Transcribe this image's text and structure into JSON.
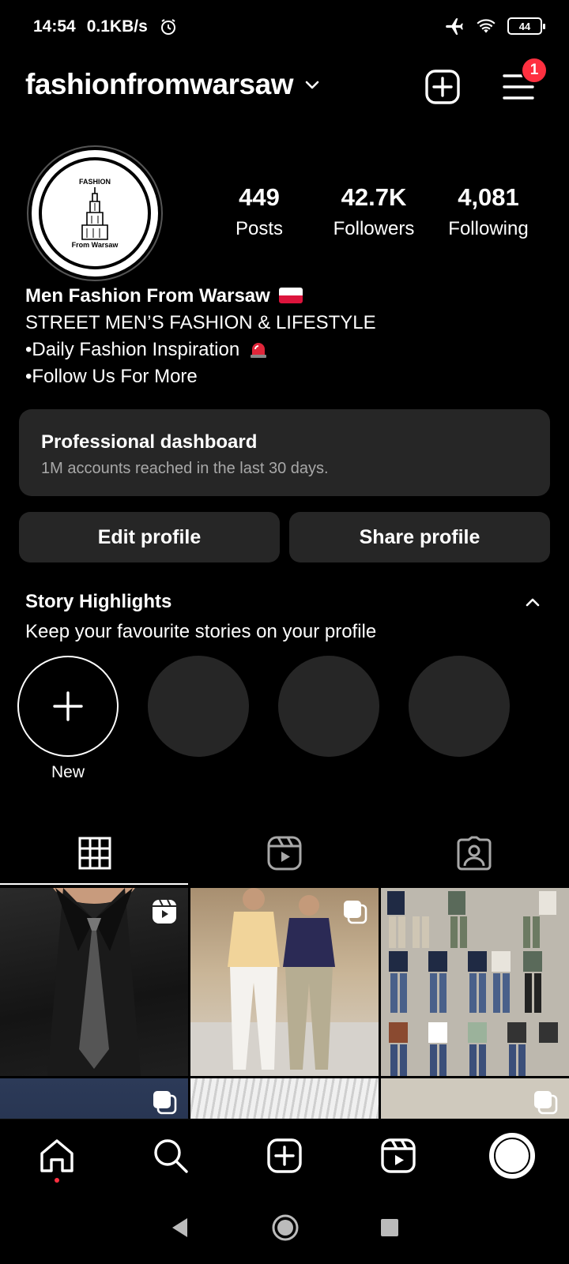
{
  "status_bar": {
    "time": "14:54",
    "network_speed": "0.1KB/s",
    "battery": "44"
  },
  "header": {
    "username": "fashionfromwarsaw",
    "notification_count": "1"
  },
  "profile": {
    "avatar_text_top": "FASHION",
    "avatar_text_bottom": "From Warsaw",
    "stats": [
      {
        "value": "449",
        "label": "Posts"
      },
      {
        "value": "42.7K",
        "label": "Followers"
      },
      {
        "value": "4,081",
        "label": "Following"
      }
    ],
    "bio": {
      "name": "Men Fashion From Warsaw",
      "line1": "STREET MEN’S FASHION & LIFESTYLE",
      "line2": "•Daily Fashion Inspiration",
      "line3": "•Follow Us For More"
    }
  },
  "dashboard": {
    "title": "Professional dashboard",
    "subtitle": "1M accounts reached in the last 30 days."
  },
  "buttons": {
    "edit": "Edit profile",
    "share": "Share profile"
  },
  "highlights": {
    "title": "Story Highlights",
    "subtitle": "Keep your favourite stories on your profile",
    "new_label": "New"
  },
  "colors": {
    "background": "#000000",
    "card": "#262626",
    "badge": "#ff3040",
    "muted_text": "#a8a8a8"
  },
  "icons": [
    "chevron-down-icon",
    "new-post-icon",
    "menu-icon",
    "plus-icon",
    "chevron-up-icon",
    "grid-icon",
    "reels-icon",
    "tagged-icon",
    "home-icon",
    "search-icon",
    "create-icon",
    "reels-nav-icon",
    "back-icon",
    "home-circle-icon",
    "recents-icon"
  ]
}
